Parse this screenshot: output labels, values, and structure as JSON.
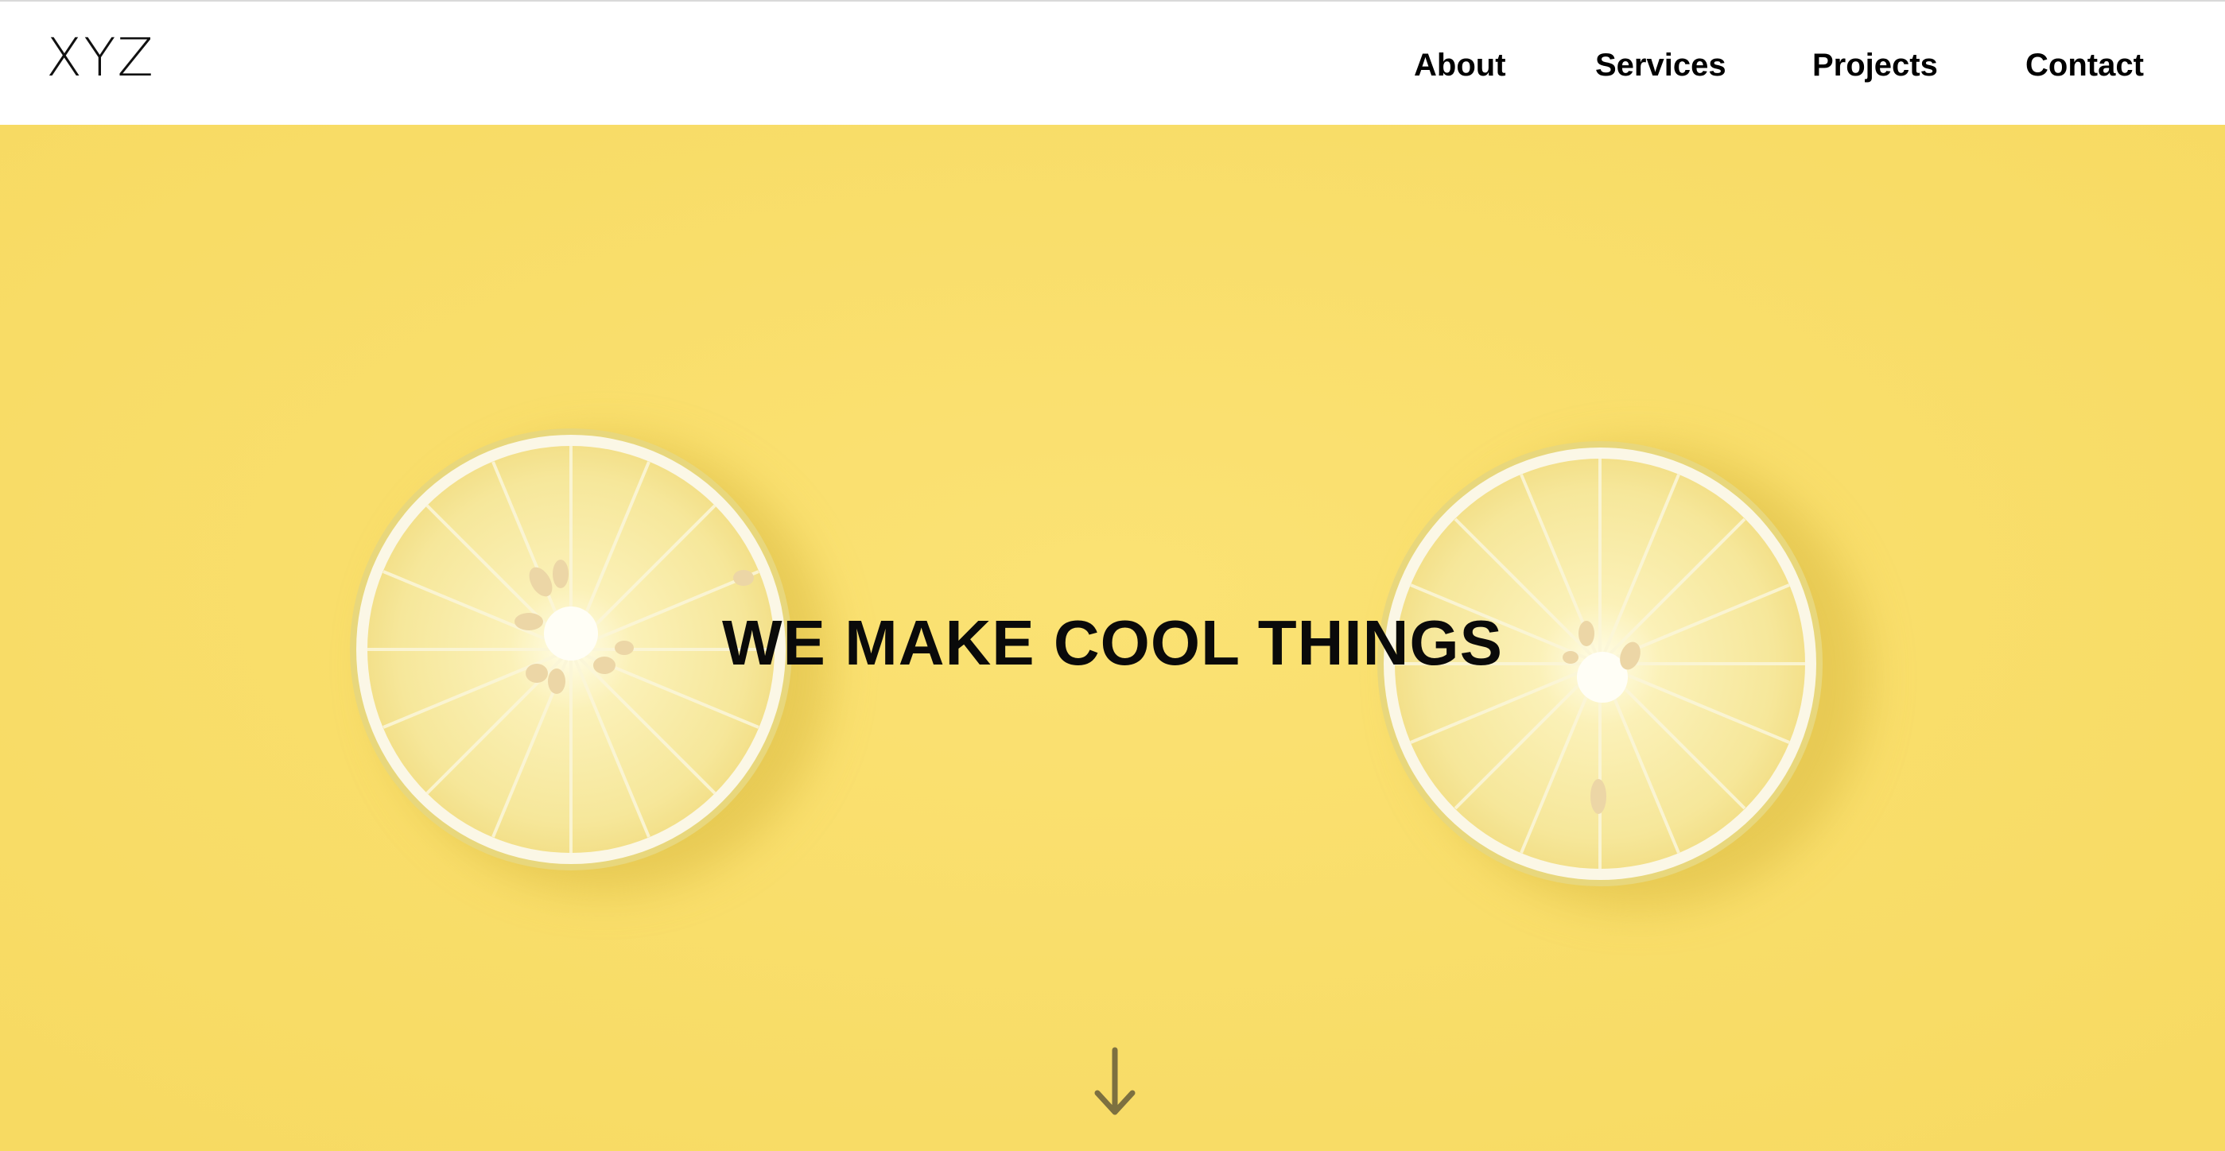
{
  "header": {
    "logo": "XYZ",
    "nav": {
      "about": "About",
      "services": "Services",
      "projects": "Projects",
      "contact": "Contact"
    }
  },
  "hero": {
    "title": "WE MAKE COOL THINGS",
    "background_color": "#f9de6c",
    "image": "lemon-slices",
    "scroll_icon": "arrow-down-icon"
  }
}
